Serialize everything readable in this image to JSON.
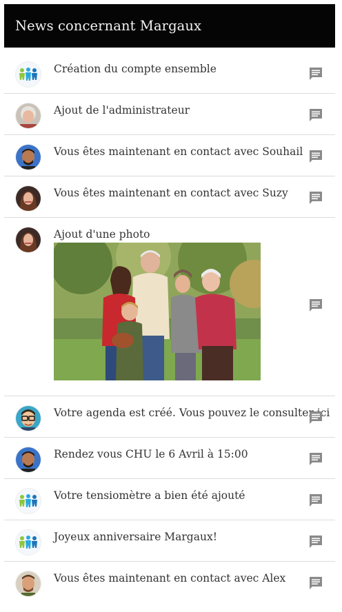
{
  "header": {
    "title": "News concernant Margaux"
  },
  "feed": [
    {
      "text": "Création du compte ensemble",
      "avatar": "ensemble-logo-icon"
    },
    {
      "text": "Ajout de l'administrateur",
      "avatar": "grandmother-avatar"
    },
    {
      "text": "Vous êtes maintenant en contact avec Souhail",
      "avatar": "souhail-avatar"
    },
    {
      "text": "Vous êtes maintenant en contact avec Suzy",
      "avatar": "suzy-avatar"
    },
    {
      "text": "Ajout d'une photo",
      "avatar": "suzy-avatar",
      "photo": "family-photo"
    },
    {
      "text": "Votre agenda est créé. Vous pouvez le consulter ici",
      "avatar": "cartoon-avatar"
    },
    {
      "text": "Rendez vous CHU le 6 Avril à 15:00",
      "avatar": "souhail-avatar"
    },
    {
      "text": "Votre tensiomètre a bien été ajouté",
      "avatar": "ensemble-logo-icon"
    },
    {
      "text": "Joyeux anniversaire Margaux!",
      "avatar": "ensemble-logo-icon"
    },
    {
      "text": "Vous êtes maintenant en contact avec Alex",
      "avatar": "alex-avatar"
    }
  ],
  "colors": {
    "header_bg": "#050505",
    "icon_gray": "#8a8a8a",
    "divider": "#dcdcdc"
  }
}
